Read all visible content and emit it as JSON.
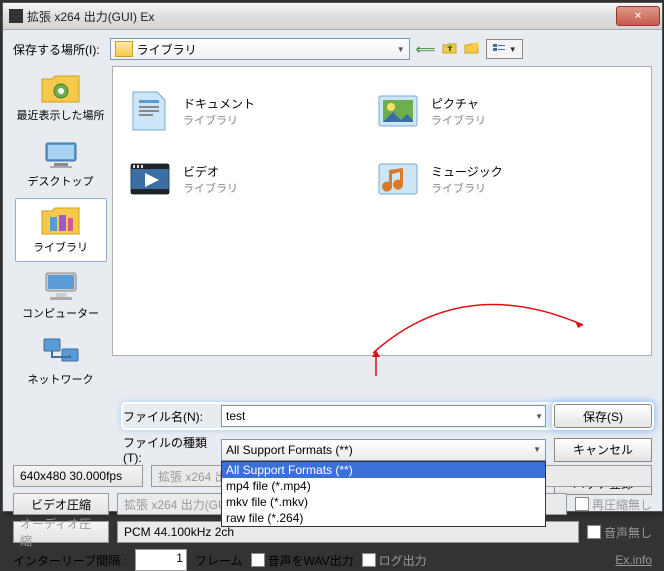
{
  "title": "拡張 x264 出力(GUI) Ex",
  "save_location_label": "保存する場所(I):",
  "location_combo": "ライブラリ",
  "sidebar": {
    "items": [
      {
        "label": "最近表示した場所"
      },
      {
        "label": "デスクトップ"
      },
      {
        "label": "ライブラリ"
      },
      {
        "label": "コンピューター"
      },
      {
        "label": "ネットワーク"
      }
    ]
  },
  "files": [
    {
      "name": "ドキュメント",
      "type": "ライブラリ"
    },
    {
      "name": "ピクチャ",
      "type": "ライブラリ"
    },
    {
      "name": "ビデオ",
      "type": "ライブラリ"
    },
    {
      "name": "ミュージック",
      "type": "ライブラリ"
    }
  ],
  "filename_label": "ファイル名(N):",
  "filename_value": "test",
  "filetype_label": "ファイルの種類(T):",
  "filetype_selected": "All Support Formats (**)",
  "filetype_options": [
    "All Support Formats (**)",
    "mp4 file (*.mp4)",
    "mkv file (*.mkv)",
    "raw file (*.264)"
  ],
  "buttons": {
    "save": "保存(S)",
    "cancel": "キャンセル",
    "batch": "バッチ登録"
  },
  "resolution_fps": "640x480  30.000fps",
  "encoder_line": "拡張 x264 出力(GUI) Ex",
  "video_comp": "ビデオ圧縮",
  "audio_comp": "オーディオ圧縮",
  "audio_format": "PCM 44.100kHz 2ch",
  "no_recompress": "再圧縮無し",
  "no_audio": "音声無し",
  "interleave_label": "インターリーブ間隔 :",
  "interleave_value": "1",
  "interleave_unit": "フレーム",
  "wav_out": "音声をWAV出力",
  "log_out": "ログ出力",
  "ex_info": "Ex.info"
}
